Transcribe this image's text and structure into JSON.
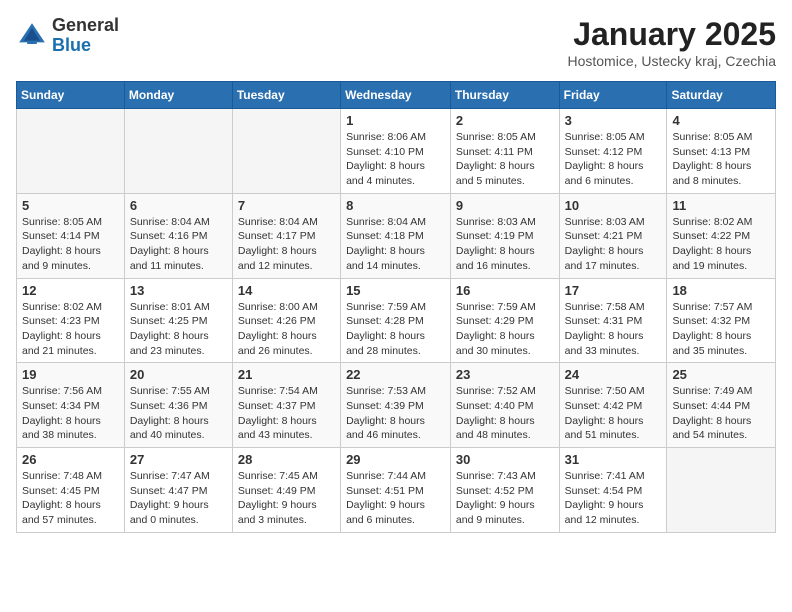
{
  "header": {
    "logo_line1": "General",
    "logo_line2": "Blue",
    "month": "January 2025",
    "location": "Hostomice, Ustecky kraj, Czechia"
  },
  "weekdays": [
    "Sunday",
    "Monday",
    "Tuesday",
    "Wednesday",
    "Thursday",
    "Friday",
    "Saturday"
  ],
  "weeks": [
    [
      {
        "day": "",
        "info": ""
      },
      {
        "day": "",
        "info": ""
      },
      {
        "day": "",
        "info": ""
      },
      {
        "day": "1",
        "info": "Sunrise: 8:06 AM\nSunset: 4:10 PM\nDaylight: 8 hours\nand 4 minutes."
      },
      {
        "day": "2",
        "info": "Sunrise: 8:05 AM\nSunset: 4:11 PM\nDaylight: 8 hours\nand 5 minutes."
      },
      {
        "day": "3",
        "info": "Sunrise: 8:05 AM\nSunset: 4:12 PM\nDaylight: 8 hours\nand 6 minutes."
      },
      {
        "day": "4",
        "info": "Sunrise: 8:05 AM\nSunset: 4:13 PM\nDaylight: 8 hours\nand 8 minutes."
      }
    ],
    [
      {
        "day": "5",
        "info": "Sunrise: 8:05 AM\nSunset: 4:14 PM\nDaylight: 8 hours\nand 9 minutes."
      },
      {
        "day": "6",
        "info": "Sunrise: 8:04 AM\nSunset: 4:16 PM\nDaylight: 8 hours\nand 11 minutes."
      },
      {
        "day": "7",
        "info": "Sunrise: 8:04 AM\nSunset: 4:17 PM\nDaylight: 8 hours\nand 12 minutes."
      },
      {
        "day": "8",
        "info": "Sunrise: 8:04 AM\nSunset: 4:18 PM\nDaylight: 8 hours\nand 14 minutes."
      },
      {
        "day": "9",
        "info": "Sunrise: 8:03 AM\nSunset: 4:19 PM\nDaylight: 8 hours\nand 16 minutes."
      },
      {
        "day": "10",
        "info": "Sunrise: 8:03 AM\nSunset: 4:21 PM\nDaylight: 8 hours\nand 17 minutes."
      },
      {
        "day": "11",
        "info": "Sunrise: 8:02 AM\nSunset: 4:22 PM\nDaylight: 8 hours\nand 19 minutes."
      }
    ],
    [
      {
        "day": "12",
        "info": "Sunrise: 8:02 AM\nSunset: 4:23 PM\nDaylight: 8 hours\nand 21 minutes."
      },
      {
        "day": "13",
        "info": "Sunrise: 8:01 AM\nSunset: 4:25 PM\nDaylight: 8 hours\nand 23 minutes."
      },
      {
        "day": "14",
        "info": "Sunrise: 8:00 AM\nSunset: 4:26 PM\nDaylight: 8 hours\nand 26 minutes."
      },
      {
        "day": "15",
        "info": "Sunrise: 7:59 AM\nSunset: 4:28 PM\nDaylight: 8 hours\nand 28 minutes."
      },
      {
        "day": "16",
        "info": "Sunrise: 7:59 AM\nSunset: 4:29 PM\nDaylight: 8 hours\nand 30 minutes."
      },
      {
        "day": "17",
        "info": "Sunrise: 7:58 AM\nSunset: 4:31 PM\nDaylight: 8 hours\nand 33 minutes."
      },
      {
        "day": "18",
        "info": "Sunrise: 7:57 AM\nSunset: 4:32 PM\nDaylight: 8 hours\nand 35 minutes."
      }
    ],
    [
      {
        "day": "19",
        "info": "Sunrise: 7:56 AM\nSunset: 4:34 PM\nDaylight: 8 hours\nand 38 minutes."
      },
      {
        "day": "20",
        "info": "Sunrise: 7:55 AM\nSunset: 4:36 PM\nDaylight: 8 hours\nand 40 minutes."
      },
      {
        "day": "21",
        "info": "Sunrise: 7:54 AM\nSunset: 4:37 PM\nDaylight: 8 hours\nand 43 minutes."
      },
      {
        "day": "22",
        "info": "Sunrise: 7:53 AM\nSunset: 4:39 PM\nDaylight: 8 hours\nand 46 minutes."
      },
      {
        "day": "23",
        "info": "Sunrise: 7:52 AM\nSunset: 4:40 PM\nDaylight: 8 hours\nand 48 minutes."
      },
      {
        "day": "24",
        "info": "Sunrise: 7:50 AM\nSunset: 4:42 PM\nDaylight: 8 hours\nand 51 minutes."
      },
      {
        "day": "25",
        "info": "Sunrise: 7:49 AM\nSunset: 4:44 PM\nDaylight: 8 hours\nand 54 minutes."
      }
    ],
    [
      {
        "day": "26",
        "info": "Sunrise: 7:48 AM\nSunset: 4:45 PM\nDaylight: 8 hours\nand 57 minutes."
      },
      {
        "day": "27",
        "info": "Sunrise: 7:47 AM\nSunset: 4:47 PM\nDaylight: 9 hours\nand 0 minutes."
      },
      {
        "day": "28",
        "info": "Sunrise: 7:45 AM\nSunset: 4:49 PM\nDaylight: 9 hours\nand 3 minutes."
      },
      {
        "day": "29",
        "info": "Sunrise: 7:44 AM\nSunset: 4:51 PM\nDaylight: 9 hours\nand 6 minutes."
      },
      {
        "day": "30",
        "info": "Sunrise: 7:43 AM\nSunset: 4:52 PM\nDaylight: 9 hours\nand 9 minutes."
      },
      {
        "day": "31",
        "info": "Sunrise: 7:41 AM\nSunset: 4:54 PM\nDaylight: 9 hours\nand 12 minutes."
      },
      {
        "day": "",
        "info": ""
      }
    ]
  ]
}
